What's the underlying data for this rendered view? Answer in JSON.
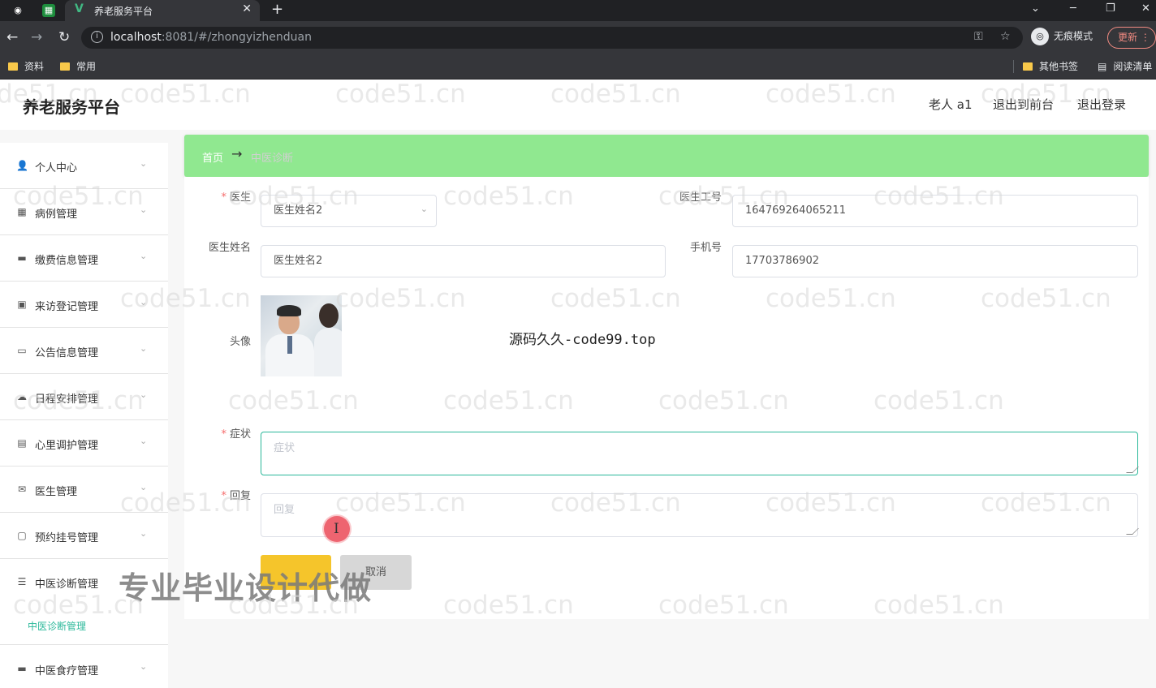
{
  "browser": {
    "tab_title": "养老服务平台",
    "url_host": "localhost",
    "url_rest": ":8081/#/zhongyizhenduan",
    "incognito_label": "无痕模式",
    "update_label": "更新",
    "bookmarks": [
      "资料",
      "常用"
    ],
    "bookmarks_right": [
      "其他书签",
      "阅读清单"
    ]
  },
  "header": {
    "brand": "养老服务平台",
    "user": "老人 a1",
    "to_front": "退出到前台",
    "logout": "退出登录"
  },
  "sidebar": {
    "items": [
      {
        "label": "个人中心",
        "icon": "user-icon"
      },
      {
        "label": "病例管理",
        "icon": "grid-icon"
      },
      {
        "label": "缴费信息管理",
        "icon": "monitor-icon"
      },
      {
        "label": "来访登记管理",
        "icon": "chart-icon"
      },
      {
        "label": "公告信息管理",
        "icon": "briefcase-icon"
      },
      {
        "label": "日程安排管理",
        "icon": "cloud-icon"
      },
      {
        "label": "心里调护管理",
        "icon": "clipboard-icon"
      },
      {
        "label": "医生管理",
        "icon": "mail-icon"
      },
      {
        "label": "预约挂号管理",
        "icon": "chat-icon"
      },
      {
        "label": "中医诊断管理",
        "icon": "list-icon"
      },
      {
        "label": "中医食疗管理",
        "icon": "monitor-icon"
      }
    ],
    "sub_item": "中医诊断管理"
  },
  "breadcrumb": {
    "home": "首页",
    "arrow": "→",
    "current": "中医诊断"
  },
  "form": {
    "doctor_label": "医生",
    "doctor_value": "医生姓名2",
    "doctor_no_label": "医生工号",
    "doctor_no_value": "164769264065211",
    "doctor_name_label": "医生姓名",
    "doctor_name_value": "医生姓名2",
    "phone_label": "手机号",
    "phone_value": "17703786902",
    "avatar_label": "头像",
    "symptom_label": "症状",
    "symptom_placeholder": "症状",
    "reply_label": "回复",
    "reply_placeholder": "回复",
    "cancel_label": "取消"
  },
  "overlays": {
    "source_text": "源码久久-code99.top",
    "promo_text": "专业毕业设计代做",
    "watermark": "code51.cn"
  }
}
